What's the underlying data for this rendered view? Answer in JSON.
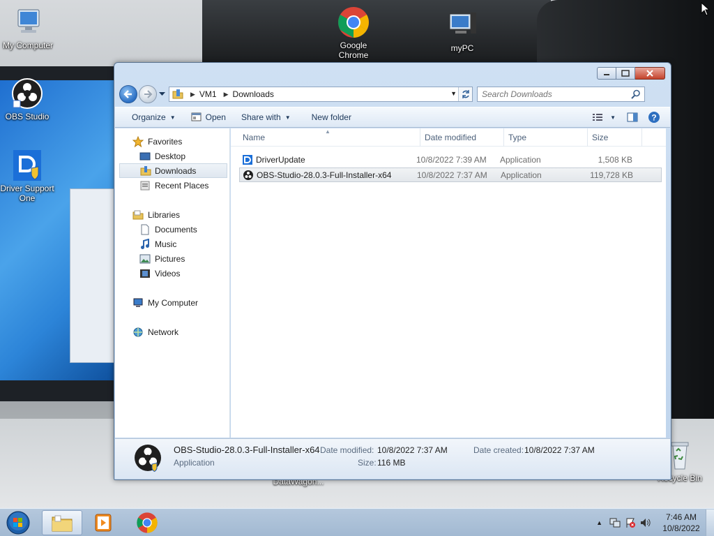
{
  "desktop": {
    "icons": [
      {
        "label": "My Computer",
        "icon": "computer-icon"
      },
      {
        "label": "OBS Studio",
        "icon": "obs-icon"
      },
      {
        "label": "Driver Support One",
        "icon": "driver-support-icon"
      },
      {
        "label": "Google Chrome",
        "icon": "chrome-icon"
      },
      {
        "label": "myPC",
        "icon": "mypc-icon"
      },
      {
        "label": "DataWagon...",
        "icon": "datawagon-icon"
      },
      {
        "label": "Recycle Bin",
        "icon": "recycle-bin-icon"
      }
    ]
  },
  "explorer": {
    "breadcrumb": [
      "VM1",
      "Downloads"
    ],
    "search_placeholder": "Search Downloads",
    "toolbar": {
      "organize": "Organize",
      "open": "Open",
      "share_with": "Share with",
      "new_folder": "New folder"
    },
    "nav": {
      "favorites": "Favorites",
      "desktop": "Desktop",
      "downloads": "Downloads",
      "recent_places": "Recent Places",
      "libraries": "Libraries",
      "documents": "Documents",
      "music": "Music",
      "pictures": "Pictures",
      "videos": "Videos",
      "my_computer": "My Computer",
      "network": "Network"
    },
    "columns": {
      "name": "Name",
      "date": "Date modified",
      "type": "Type",
      "size": "Size"
    },
    "files": [
      {
        "name": "DriverUpdate",
        "date": "10/8/2022 7:39 AM",
        "type": "Application",
        "size": "1,508 KB"
      },
      {
        "name": "OBS-Studio-28.0.3-Full-Installer-x64",
        "date": "10/8/2022 7:37 AM",
        "type": "Application",
        "size": "119,728 KB"
      }
    ],
    "details": {
      "name": "OBS-Studio-28.0.3-Full-Installer-x64",
      "type": "Application",
      "date_modified_label": "Date modified:",
      "date_modified": "10/8/2022 7:37 AM",
      "date_created_label": "Date created:",
      "date_created": "10/8/2022 7:37 AM",
      "size_label": "Size:",
      "size": "116 MB"
    }
  },
  "taskbar": {
    "time": "7:46 AM",
    "date": "10/8/2022"
  },
  "colors": {
    "accent": "#2b6fc4",
    "window_frame": "#bfd4ec",
    "close_button": "#c4432b"
  }
}
